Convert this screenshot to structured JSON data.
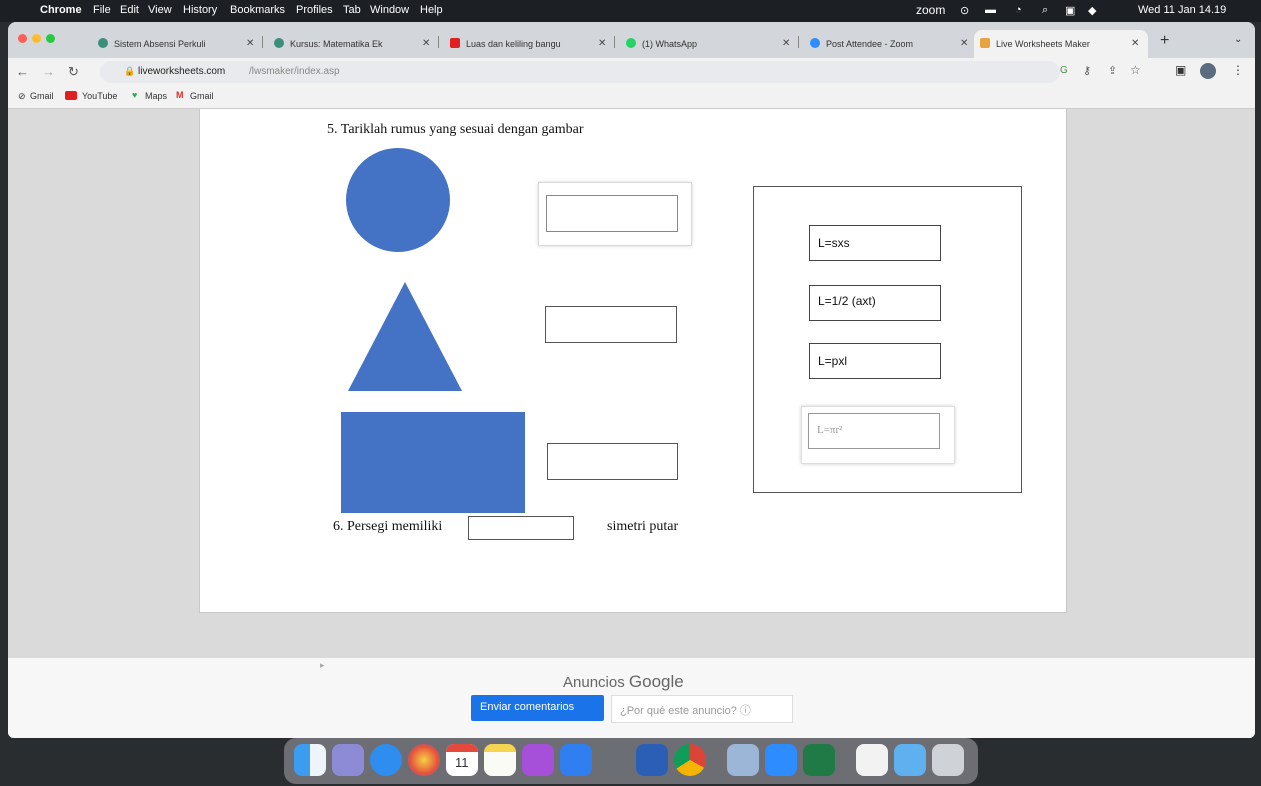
{
  "menubar": {
    "app": "Chrome",
    "items": [
      "File",
      "Edit",
      "View",
      "History",
      "Bookmarks",
      "Profiles",
      "Tab",
      "Window",
      "Help"
    ],
    "zoom_label": "zoom",
    "datetime": "Wed 11 Jan 14.19"
  },
  "tabs": [
    {
      "label": "Sistem Absensi Perkuli",
      "color": "#3c8d7a"
    },
    {
      "label": "Kursus: Matematika Ek",
      "color": "#3c8d7a"
    },
    {
      "label": "Luas dan keliling bangu",
      "color": "#e02020"
    },
    {
      "label": "(1) WhatsApp",
      "color": "#25d366"
    },
    {
      "label": "Post Attendee - Zoom",
      "color": "#2d8cff"
    },
    {
      "label": "Live Worksheets Maker",
      "color": "#e7a33e"
    }
  ],
  "url": {
    "domain": "liveworksheets.com",
    "path": "/lwsmaker/index.asp"
  },
  "bookmarks": [
    "Gmail",
    "YouTube",
    "Maps",
    "Gmail"
  ],
  "worksheet": {
    "q5": "5.  Tariklah rumus yang sesuai dengan gambar",
    "options": [
      "L=sxs",
      "L=1/2 (axt)",
      "L=pxl",
      "L=πr²"
    ],
    "q6_prefix": "6.  Persegi memiliki",
    "q6_suffix": "simetri putar"
  },
  "ads": {
    "label_prefix": "Anuncios",
    "label_brand": "Google",
    "feedback_button": "Enviar comentarios",
    "why_button": "¿Por qué este anuncio? ⓘ"
  },
  "colors": {
    "shape_fill": "#4472c4",
    "accent": "#1a73e8"
  },
  "dock_icons": [
    "finder-icon",
    "launchpad-icon",
    "safari-icon",
    "photos-icon",
    "calendar-icon",
    "notes-icon",
    "podcasts-icon",
    "app-store-icon",
    "system-preferences-icon",
    "word-icon",
    "chrome-icon",
    "preview-icon",
    "zoom-icon",
    "excel-icon",
    "document-icon",
    "folder-icon",
    "trash-icon"
  ],
  "calendar_day": "11"
}
